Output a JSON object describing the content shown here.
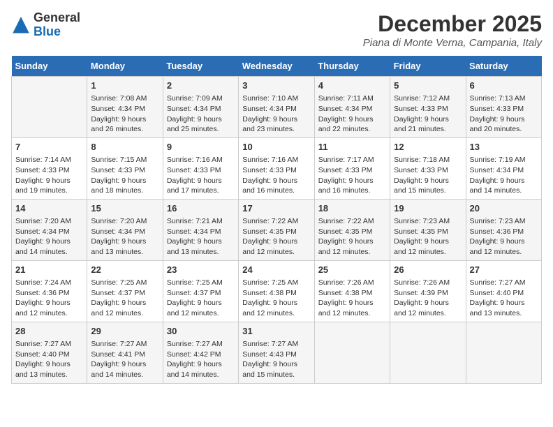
{
  "logo": {
    "general": "General",
    "blue": "Blue"
  },
  "title": "December 2025",
  "location": "Piana di Monte Verna, Campania, Italy",
  "days_of_week": [
    "Sunday",
    "Monday",
    "Tuesday",
    "Wednesday",
    "Thursday",
    "Friday",
    "Saturday"
  ],
  "weeks": [
    [
      {
        "day": "",
        "info": ""
      },
      {
        "day": "1",
        "info": "Sunrise: 7:08 AM\nSunset: 4:34 PM\nDaylight: 9 hours\nand 26 minutes."
      },
      {
        "day": "2",
        "info": "Sunrise: 7:09 AM\nSunset: 4:34 PM\nDaylight: 9 hours\nand 25 minutes."
      },
      {
        "day": "3",
        "info": "Sunrise: 7:10 AM\nSunset: 4:34 PM\nDaylight: 9 hours\nand 23 minutes."
      },
      {
        "day": "4",
        "info": "Sunrise: 7:11 AM\nSunset: 4:34 PM\nDaylight: 9 hours\nand 22 minutes."
      },
      {
        "day": "5",
        "info": "Sunrise: 7:12 AM\nSunset: 4:33 PM\nDaylight: 9 hours\nand 21 minutes."
      },
      {
        "day": "6",
        "info": "Sunrise: 7:13 AM\nSunset: 4:33 PM\nDaylight: 9 hours\nand 20 minutes."
      }
    ],
    [
      {
        "day": "7",
        "info": "Sunrise: 7:14 AM\nSunset: 4:33 PM\nDaylight: 9 hours\nand 19 minutes."
      },
      {
        "day": "8",
        "info": "Sunrise: 7:15 AM\nSunset: 4:33 PM\nDaylight: 9 hours\nand 18 minutes."
      },
      {
        "day": "9",
        "info": "Sunrise: 7:16 AM\nSunset: 4:33 PM\nDaylight: 9 hours\nand 17 minutes."
      },
      {
        "day": "10",
        "info": "Sunrise: 7:16 AM\nSunset: 4:33 PM\nDaylight: 9 hours\nand 16 minutes."
      },
      {
        "day": "11",
        "info": "Sunrise: 7:17 AM\nSunset: 4:33 PM\nDaylight: 9 hours\nand 16 minutes."
      },
      {
        "day": "12",
        "info": "Sunrise: 7:18 AM\nSunset: 4:33 PM\nDaylight: 9 hours\nand 15 minutes."
      },
      {
        "day": "13",
        "info": "Sunrise: 7:19 AM\nSunset: 4:34 PM\nDaylight: 9 hours\nand 14 minutes."
      }
    ],
    [
      {
        "day": "14",
        "info": "Sunrise: 7:20 AM\nSunset: 4:34 PM\nDaylight: 9 hours\nand 14 minutes."
      },
      {
        "day": "15",
        "info": "Sunrise: 7:20 AM\nSunset: 4:34 PM\nDaylight: 9 hours\nand 13 minutes."
      },
      {
        "day": "16",
        "info": "Sunrise: 7:21 AM\nSunset: 4:34 PM\nDaylight: 9 hours\nand 13 minutes."
      },
      {
        "day": "17",
        "info": "Sunrise: 7:22 AM\nSunset: 4:35 PM\nDaylight: 9 hours\nand 12 minutes."
      },
      {
        "day": "18",
        "info": "Sunrise: 7:22 AM\nSunset: 4:35 PM\nDaylight: 9 hours\nand 12 minutes."
      },
      {
        "day": "19",
        "info": "Sunrise: 7:23 AM\nSunset: 4:35 PM\nDaylight: 9 hours\nand 12 minutes."
      },
      {
        "day": "20",
        "info": "Sunrise: 7:23 AM\nSunset: 4:36 PM\nDaylight: 9 hours\nand 12 minutes."
      }
    ],
    [
      {
        "day": "21",
        "info": "Sunrise: 7:24 AM\nSunset: 4:36 PM\nDaylight: 9 hours\nand 12 minutes."
      },
      {
        "day": "22",
        "info": "Sunrise: 7:25 AM\nSunset: 4:37 PM\nDaylight: 9 hours\nand 12 minutes."
      },
      {
        "day": "23",
        "info": "Sunrise: 7:25 AM\nSunset: 4:37 PM\nDaylight: 9 hours\nand 12 minutes."
      },
      {
        "day": "24",
        "info": "Sunrise: 7:25 AM\nSunset: 4:38 PM\nDaylight: 9 hours\nand 12 minutes."
      },
      {
        "day": "25",
        "info": "Sunrise: 7:26 AM\nSunset: 4:38 PM\nDaylight: 9 hours\nand 12 minutes."
      },
      {
        "day": "26",
        "info": "Sunrise: 7:26 AM\nSunset: 4:39 PM\nDaylight: 9 hours\nand 12 minutes."
      },
      {
        "day": "27",
        "info": "Sunrise: 7:27 AM\nSunset: 4:40 PM\nDaylight: 9 hours\nand 13 minutes."
      }
    ],
    [
      {
        "day": "28",
        "info": "Sunrise: 7:27 AM\nSunset: 4:40 PM\nDaylight: 9 hours\nand 13 minutes."
      },
      {
        "day": "29",
        "info": "Sunrise: 7:27 AM\nSunset: 4:41 PM\nDaylight: 9 hours\nand 14 minutes."
      },
      {
        "day": "30",
        "info": "Sunrise: 7:27 AM\nSunset: 4:42 PM\nDaylight: 9 hours\nand 14 minutes."
      },
      {
        "day": "31",
        "info": "Sunrise: 7:27 AM\nSunset: 4:43 PM\nDaylight: 9 hours\nand 15 minutes."
      },
      {
        "day": "",
        "info": ""
      },
      {
        "day": "",
        "info": ""
      },
      {
        "day": "",
        "info": ""
      }
    ]
  ]
}
